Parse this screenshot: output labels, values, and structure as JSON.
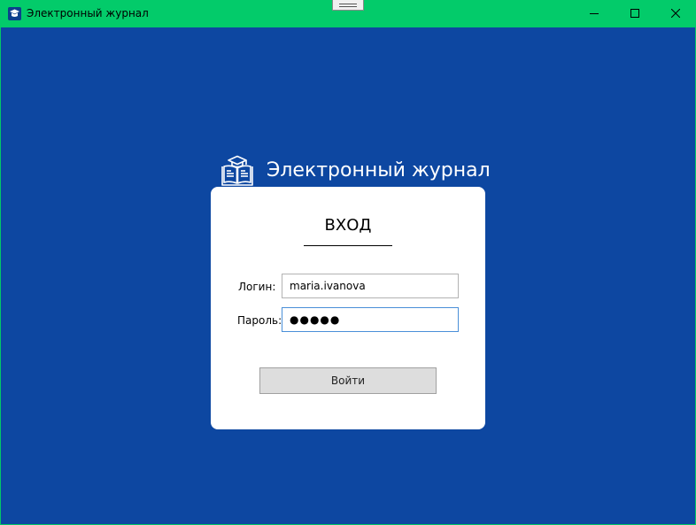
{
  "window": {
    "title": "Электронный журнал",
    "icon": "graduation-cap-icon"
  },
  "header": {
    "title": "Электронный журнал",
    "icon": "book-graduation-icon"
  },
  "login_form": {
    "heading": "ВХОД",
    "login_label": "Логин:",
    "login_value": "maria.ivanova",
    "password_label": "Пароль:",
    "password_value": "●●●●●",
    "submit_label": "Войти"
  },
  "colors": {
    "titlebar": "#03cb6a",
    "background": "#0d47a1",
    "card": "#ffffff",
    "button": "#dddddd",
    "focus_border": "#4a8fd8"
  }
}
